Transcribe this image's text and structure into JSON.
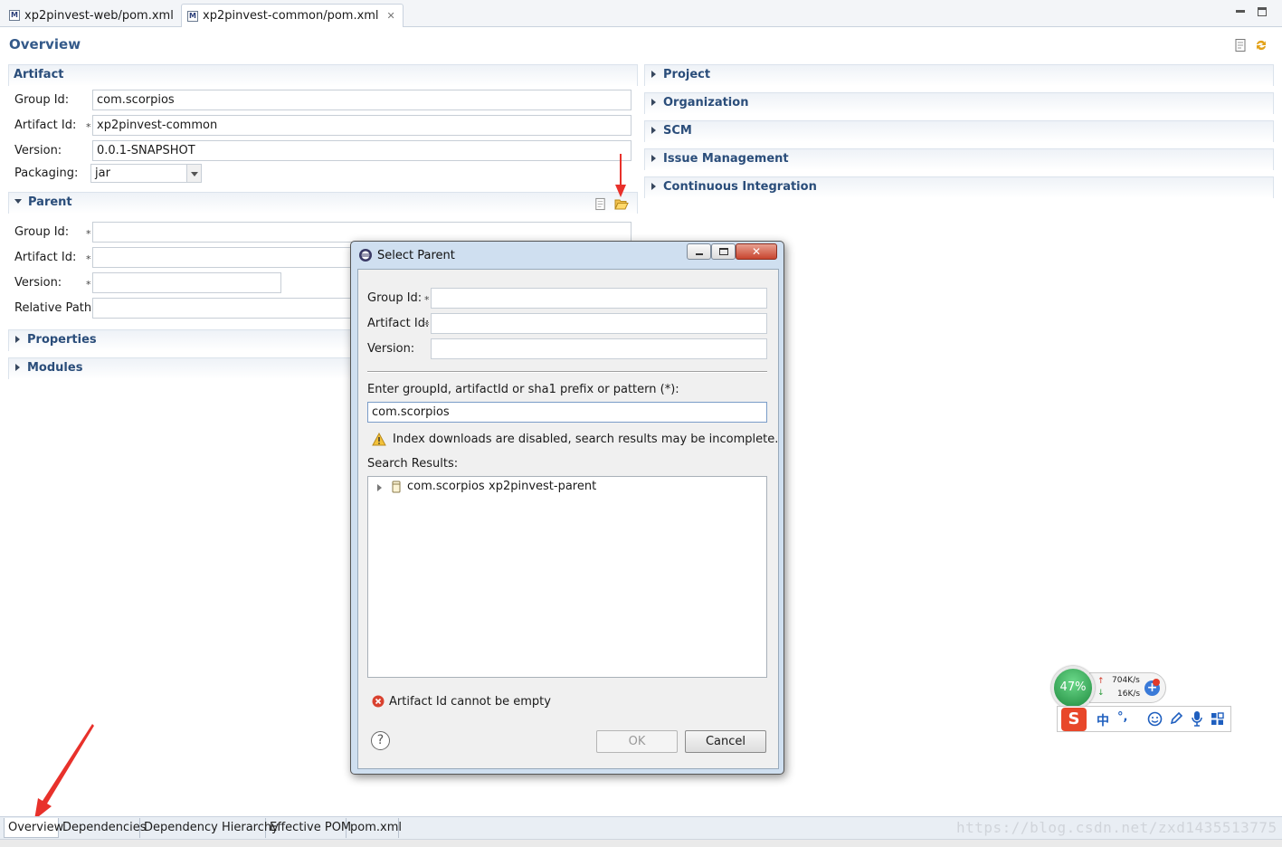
{
  "editor_tabs": [
    {
      "label": "xp2pinvest-web/pom.xml",
      "icon": "maven-pom-icon"
    },
    {
      "label": "xp2pinvest-common/pom.xml",
      "icon": "maven-pom-icon",
      "close": "✕"
    }
  ],
  "overview": {
    "title": "Overview"
  },
  "artifact": {
    "title": "Artifact",
    "group_id_label": "Group Id:",
    "group_id_value": "com.scorpios",
    "artifact_id_label": "Artifact Id:",
    "artifact_id_value": "xp2pinvest-common",
    "version_label": "Version:",
    "version_value": "0.0.1-SNAPSHOT",
    "packaging_label": "Packaging:",
    "packaging_value": "jar",
    "required_marker": "*"
  },
  "parent": {
    "title": "Parent",
    "group_id_label": "Group Id:",
    "group_id_value": "",
    "artifact_id_label": "Artifact Id:",
    "artifact_id_value": "",
    "version_label": "Version:",
    "version_value": "",
    "relative_path_label": "Relative Path:",
    "relative_path_value": "",
    "required_marker": "*"
  },
  "collapsed_left": {
    "properties": "Properties",
    "modules": "Modules"
  },
  "right_sections": [
    "Project",
    "Organization",
    "SCM",
    "Issue Management",
    "Continuous Integration"
  ],
  "dialog": {
    "title": "Select Parent",
    "group_id_label": "Group Id:",
    "group_id_value": "",
    "artifact_id_label": "Artifact Id:",
    "artifact_id_value": "",
    "version_label": "Version:",
    "version_value": "",
    "required_marker": "*",
    "search_label": "Enter groupId, artifactId or sha1 prefix or pattern (*):",
    "search_value": "com.scorpios",
    "warning": "Index downloads are disabled, search results may be incomplete.",
    "results_label": "Search Results:",
    "result_group": "com.scorpios",
    "result_artifact": "xp2pinvest-parent",
    "error": "Artifact Id cannot be empty",
    "ok_label": "OK",
    "cancel_label": "Cancel",
    "help_glyph": "?"
  },
  "bottom_tabs": [
    "Overview",
    "Dependencies",
    "Dependency Hierarchy",
    "Effective POM",
    "pom.xml"
  ],
  "watermark": "https://blog.csdn.net/zxd1435513775",
  "ime_widget": {
    "cpu": "47%",
    "upload": "704K/s",
    "download": "16K/s",
    "lang": "中",
    "punct": "°,",
    "logo_letter": "S"
  },
  "colors": {
    "section_title": "#2a4d7a",
    "overview_title": "#345a8a",
    "annotation_arrow": "#e8312b",
    "ime_green": "#2fa84f",
    "ime_logo": "#e8472a"
  }
}
